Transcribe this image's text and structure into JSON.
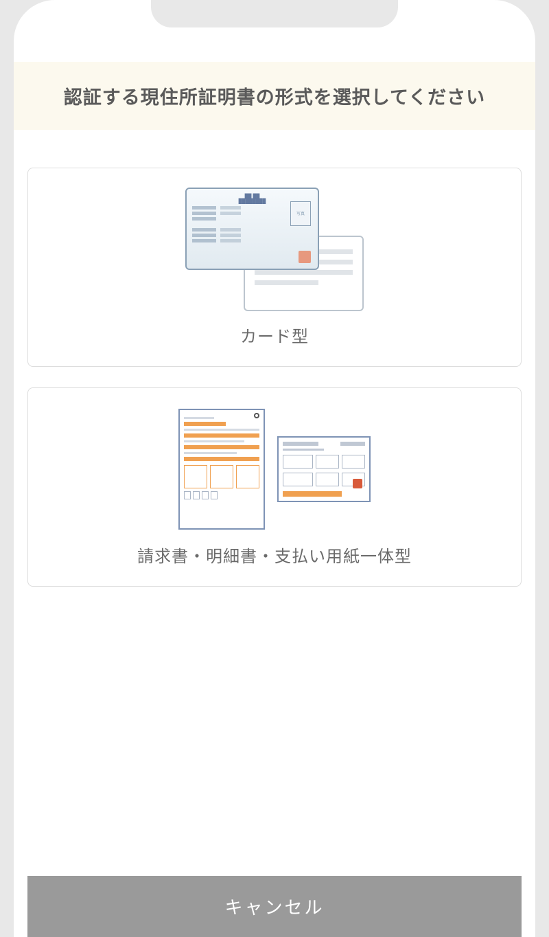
{
  "header": {
    "title": "認証する現住所証明書の形式を選択してください"
  },
  "options": [
    {
      "label": "カード型"
    },
    {
      "label": "請求書・明細書・支払い用紙一体型"
    }
  ],
  "footer": {
    "cancel_label": "キャンセル"
  }
}
